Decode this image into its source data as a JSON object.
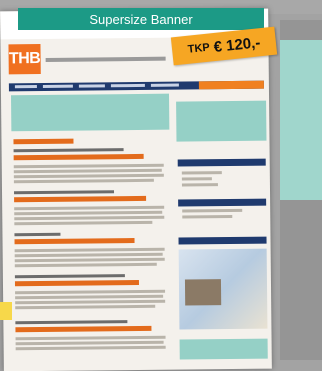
{
  "banner": {
    "label": "Supersize Banner"
  },
  "price": {
    "prefix": "TKP",
    "amount": "€ 120,-"
  },
  "site": {
    "logo_text": "THB"
  },
  "colors": {
    "banner_bg": "#1c9a86",
    "price_bg": "#f6a623",
    "ad_slot": "#95d0c6",
    "nav": "#1f3a6e",
    "accent": "#e36b1c"
  }
}
